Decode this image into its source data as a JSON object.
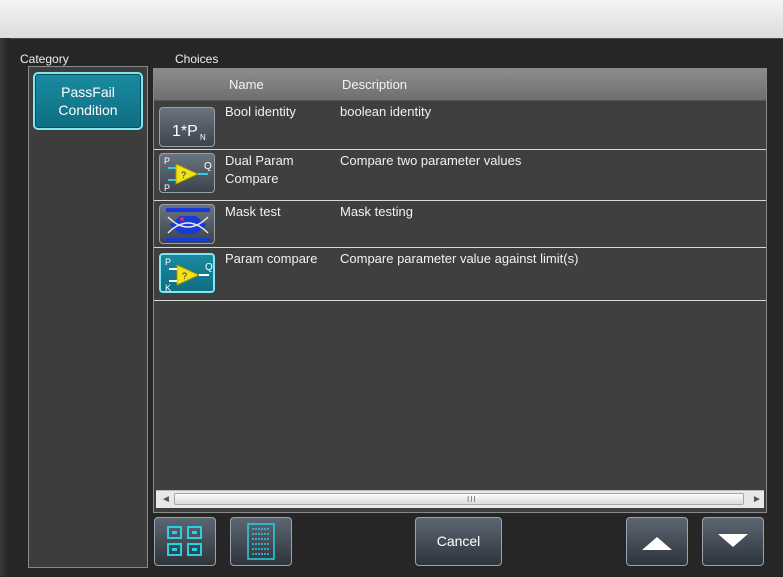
{
  "headers": {
    "category": "Category",
    "choices": "Choices"
  },
  "category": {
    "selected_line1": "PassFail",
    "selected_line2": "Condition"
  },
  "columns": {
    "name": "Name",
    "description": "Description"
  },
  "rows": [
    {
      "name": "Bool identity",
      "description": "boolean identity",
      "icon": "bool-identity-icon"
    },
    {
      "name": "Dual Param Compare",
      "description": "Compare two parameter values",
      "icon": "dual-param-compare-icon"
    },
    {
      "name": "Mask test",
      "description": "Mask testing",
      "icon": "mask-test-icon"
    },
    {
      "name": "Param compare",
      "description": "Compare parameter value against limit(s)",
      "icon": "param-compare-icon"
    }
  ],
  "icon_labels": {
    "bool_identity": "1*P",
    "bool_identity_sub": "N",
    "p": "P",
    "q": "Q",
    "k": "K",
    "question": "?"
  },
  "scrollbar": {
    "left_arrow": "◄",
    "right_arrow": "►",
    "grip": "III"
  },
  "footer": {
    "cancel_label": "Cancel"
  },
  "colors": {
    "accent": "#1a8aa0",
    "accent_border": "#7fe6f2"
  }
}
